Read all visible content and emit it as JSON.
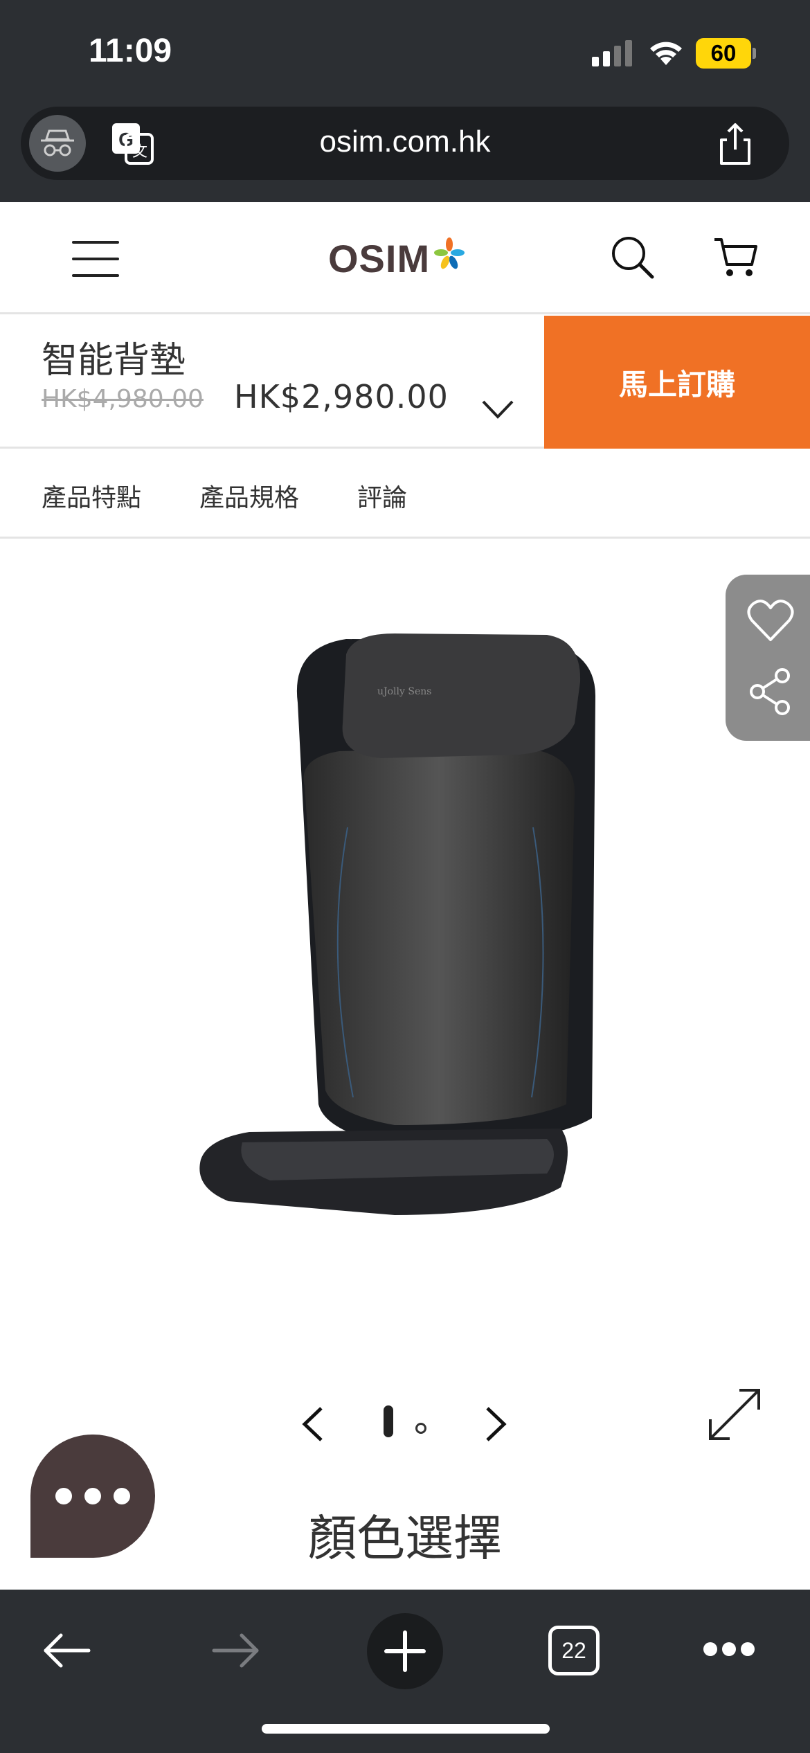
{
  "status_bar": {
    "time": "11:09",
    "battery_level": "60",
    "battery_color": "#ffd60a",
    "icons": [
      "signal-icon",
      "wifi-icon",
      "battery-icon"
    ]
  },
  "browser": {
    "url": "osim.com.hk",
    "open_tabs_count": "22",
    "icons": [
      "incognito-icon",
      "translate-icon",
      "share-icon",
      "back-arrow-icon",
      "forward-arrow-icon",
      "plus-icon",
      "tabs-icon",
      "more-icon"
    ]
  },
  "header": {
    "logo_text": "OSIM",
    "icons": [
      "menu-icon",
      "search-icon",
      "cart-icon"
    ]
  },
  "product": {
    "name": "智能背墊",
    "original_price": "HK$4,980.00",
    "sale_price": "HK$2,980.00",
    "buy_label": "馬上訂購",
    "accent_color": "#f07125"
  },
  "tabs": [
    {
      "label": "產品特點"
    },
    {
      "label": "產品規格"
    },
    {
      "label": "評論"
    }
  ],
  "gallery": {
    "current_index": 1,
    "total_images": 2,
    "icons": [
      "chevron-left-icon",
      "chevron-right-icon",
      "expand-icon",
      "heart-icon",
      "share-icon"
    ]
  },
  "section": {
    "color_selection_title": "顏色選擇"
  }
}
